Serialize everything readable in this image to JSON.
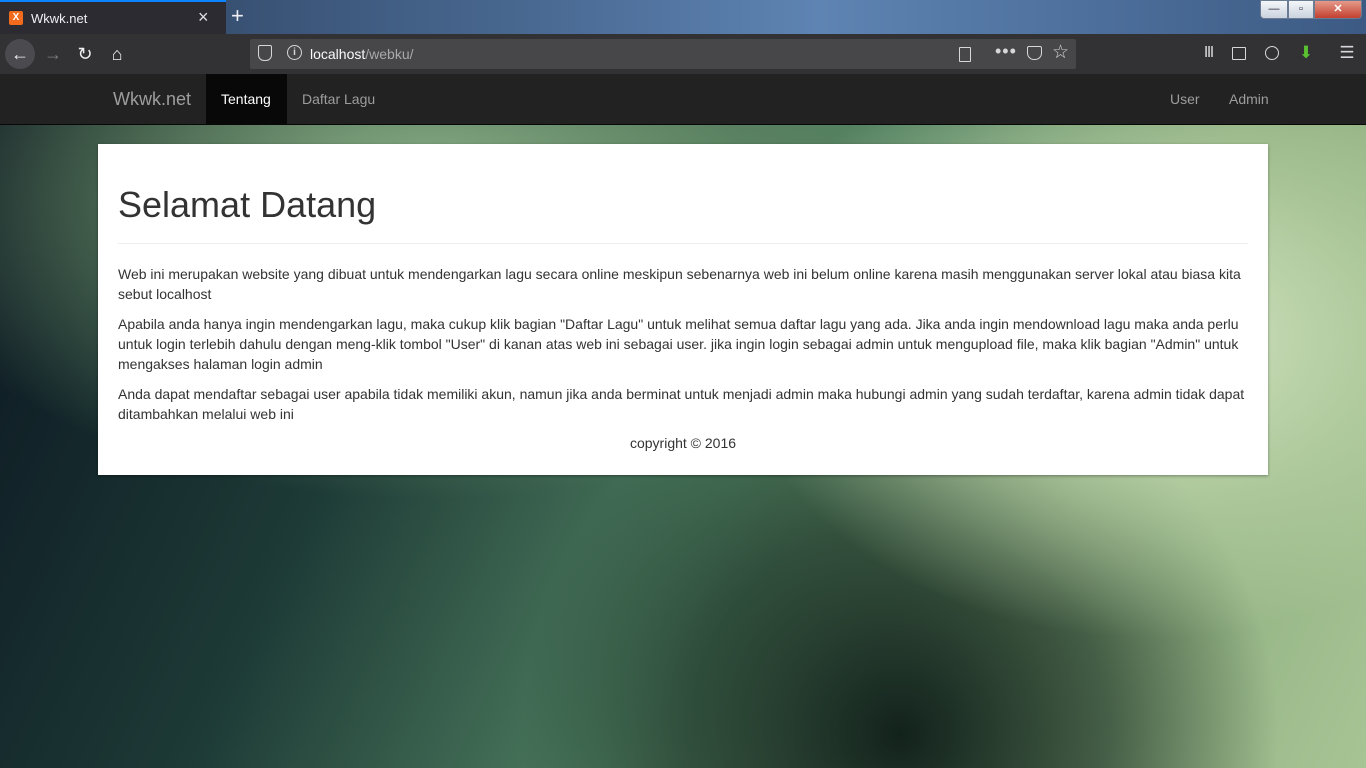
{
  "browser": {
    "tab_title": "Wkwk.net",
    "favicon": "xampp-icon",
    "new_tab": "+",
    "url_host": "localhost",
    "url_path": "/webku/",
    "more_label": "•••",
    "window_controls": {
      "minimize": "—",
      "maximize": "▫",
      "close": "✕"
    }
  },
  "site": {
    "brand": "Wkwk.net",
    "nav_left": [
      "Tentang",
      "Daftar Lagu"
    ],
    "nav_right": [
      "User",
      "Admin"
    ],
    "active_tab": "Tentang"
  },
  "main": {
    "heading": "Selamat Datang",
    "paragraphs": [
      "Web ini merupakan website yang dibuat untuk mendengarkan lagu secara online meskipun sebenarnya web ini belum online karena masih menggunakan server lokal atau biasa kita sebut localhost",
      "Apabila anda hanya ingin mendengarkan lagu, maka cukup klik bagian \"Daftar Lagu\" untuk melihat semua daftar lagu yang ada. Jika anda ingin mendownload lagu maka anda perlu untuk login terlebih dahulu dengan meng-klik tombol \"User\" di kanan atas web ini sebagai user. jika ingin login sebagai admin untuk mengupload file, maka klik bagian \"Admin\" untuk mengakses halaman login admin",
      "Anda dapat mendaftar sebagai user apabila tidak memiliki akun, namun jika anda berminat untuk menjadi admin maka hubungi admin yang sudah terdaftar, karena admin tidak dapat ditambahkan melalui web ini"
    ],
    "copyright": "copyright © 2016"
  },
  "colors": {
    "navbar_bg": "#222222",
    "active_nav_bg": "#080808",
    "link_color": "#9d9d9d",
    "text_color": "#333333"
  }
}
